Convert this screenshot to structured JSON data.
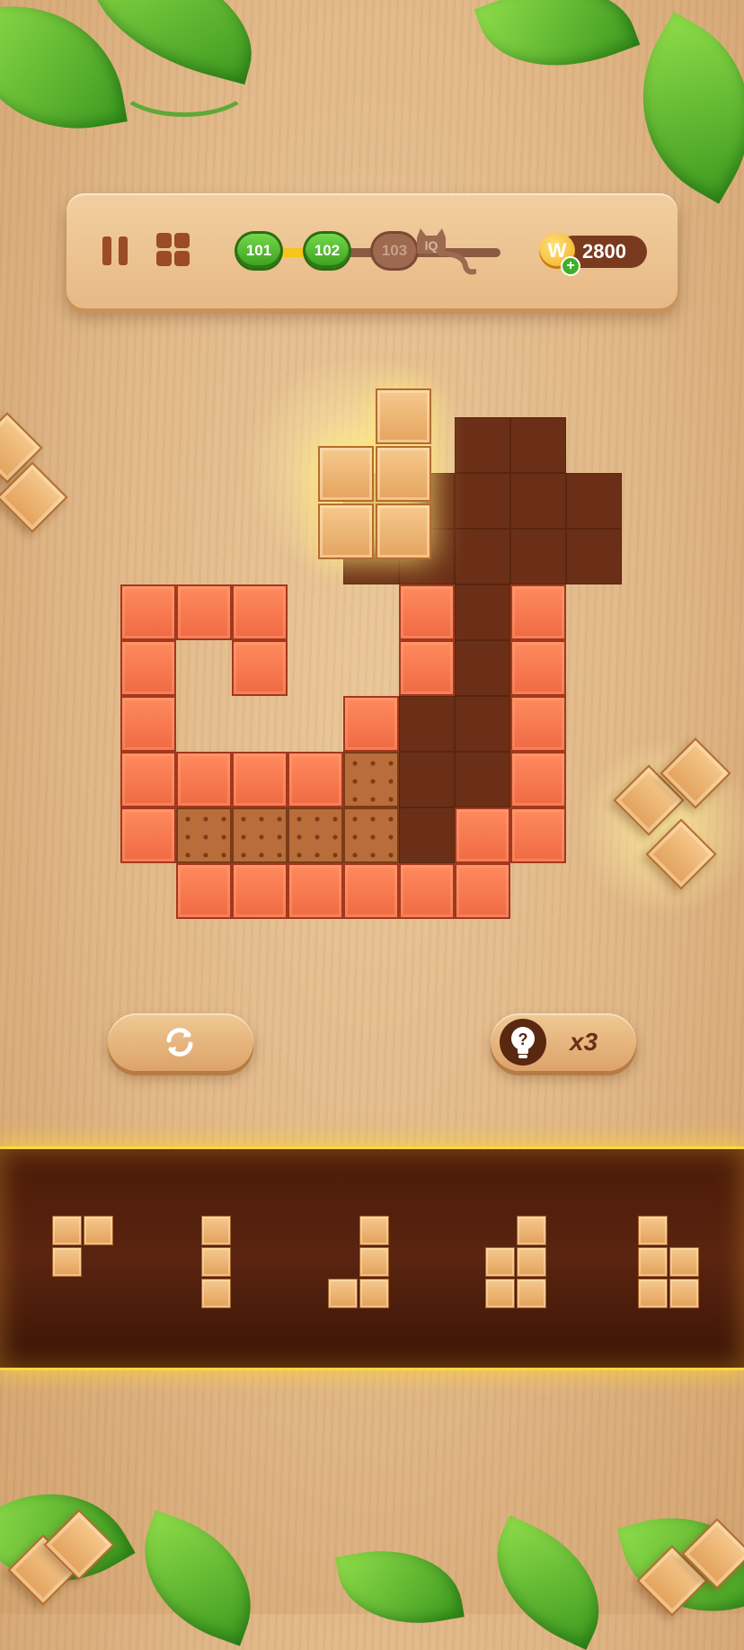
{
  "topbar": {
    "levels": [
      {
        "label": "101",
        "status": "completed"
      },
      {
        "label": "102",
        "status": "current"
      },
      {
        "label": "103",
        "status": "locked"
      }
    ],
    "iq_label": "IQ",
    "coin_symbol": "W",
    "coins": "2800",
    "coin_add": "+"
  },
  "controls": {
    "hint_count": "x3"
  },
  "board": {
    "held_piece_shape": "T-tetromino",
    "colors": {
      "filled": "#f27a4f",
      "empty_slot": "#6b2f17",
      "wood": "#eab877",
      "tray_glow": "#ffd83a"
    }
  },
  "tray": {
    "pieces": [
      {
        "name": "L-small-triomino"
      },
      {
        "name": "I-triomino"
      },
      {
        "name": "J-tetromino"
      },
      {
        "name": "P-pentomino"
      },
      {
        "name": "P-pentomino-mirrored"
      }
    ]
  }
}
